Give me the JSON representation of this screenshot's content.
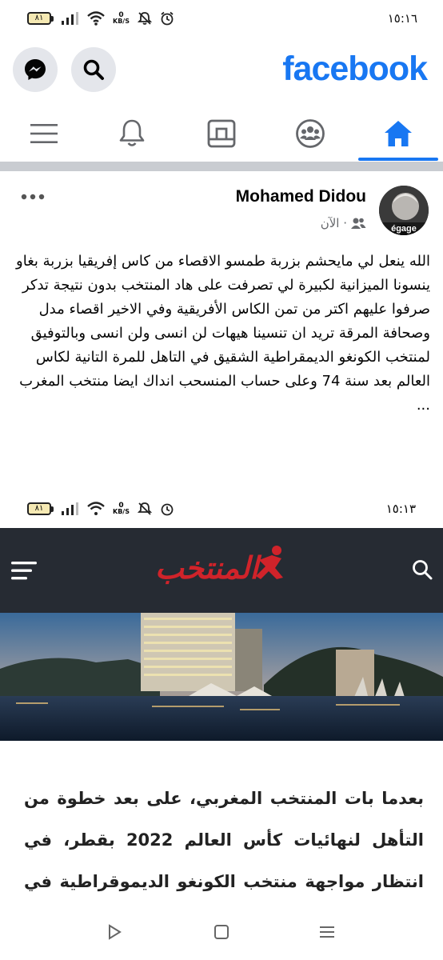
{
  "status_bar": {
    "battery": "٨١",
    "speed_top": "KB/S",
    "time": "١٥:١٦"
  },
  "header": {
    "logo": "facebook",
    "messenger_icon": "messenger-icon",
    "search_icon": "search-icon"
  },
  "tabs": [
    {
      "name": "menu",
      "icon": "menu-icon",
      "active": false
    },
    {
      "name": "notifications",
      "icon": "bell-icon",
      "active": false
    },
    {
      "name": "marketplace",
      "icon": "marketplace-icon",
      "active": false
    },
    {
      "name": "groups",
      "icon": "groups-icon",
      "active": false
    },
    {
      "name": "home",
      "icon": "home-icon",
      "active": true
    }
  ],
  "post": {
    "author": "Mohamed Didou",
    "time": "الآن ·",
    "audience_icon": "friends-icon",
    "avatar_label": "égage",
    "text": "الله ينعل لي مايحشم بزربة طمسو الاقصاء من كاس إفريقيا بزربة بغاو ينسونا الميزانية لكبيرة لي تصرفت على هاد المنتخب بدون نتيجة تدكر صرفوا عليهم اكتر من تمن الكاس الأفريقية وفي الاخير اقصاء مدل وصحافة المرقة تريد ان تنسينا هيهات لن انسى ولن انسى وبالتوفيق لمنتخب الكونغو الديمقراطية الشقيق في التاهل للمرة التانية لكاس العالم بعد سنة 74 وعلى حساب المنسحب انداك ايضا منتخب المغرب ..."
  },
  "embedded_screenshot": {
    "status_bar": {
      "battery": "٨١",
      "speed": "KB/S",
      "time": "١٥:١٣"
    },
    "site_logo": "المنتخب",
    "article_text": "بعدما بات المنتخب المغربي، على بعد خطوة من التأهل لنهائيات كأس العالم 2022 بقطر، في انتظار مواجهة منتخب الكونغو الديموقراطية في"
  },
  "colors": {
    "brand": "#1877f2",
    "nav_dark": "#262b33",
    "site_red": "#d0232a"
  }
}
